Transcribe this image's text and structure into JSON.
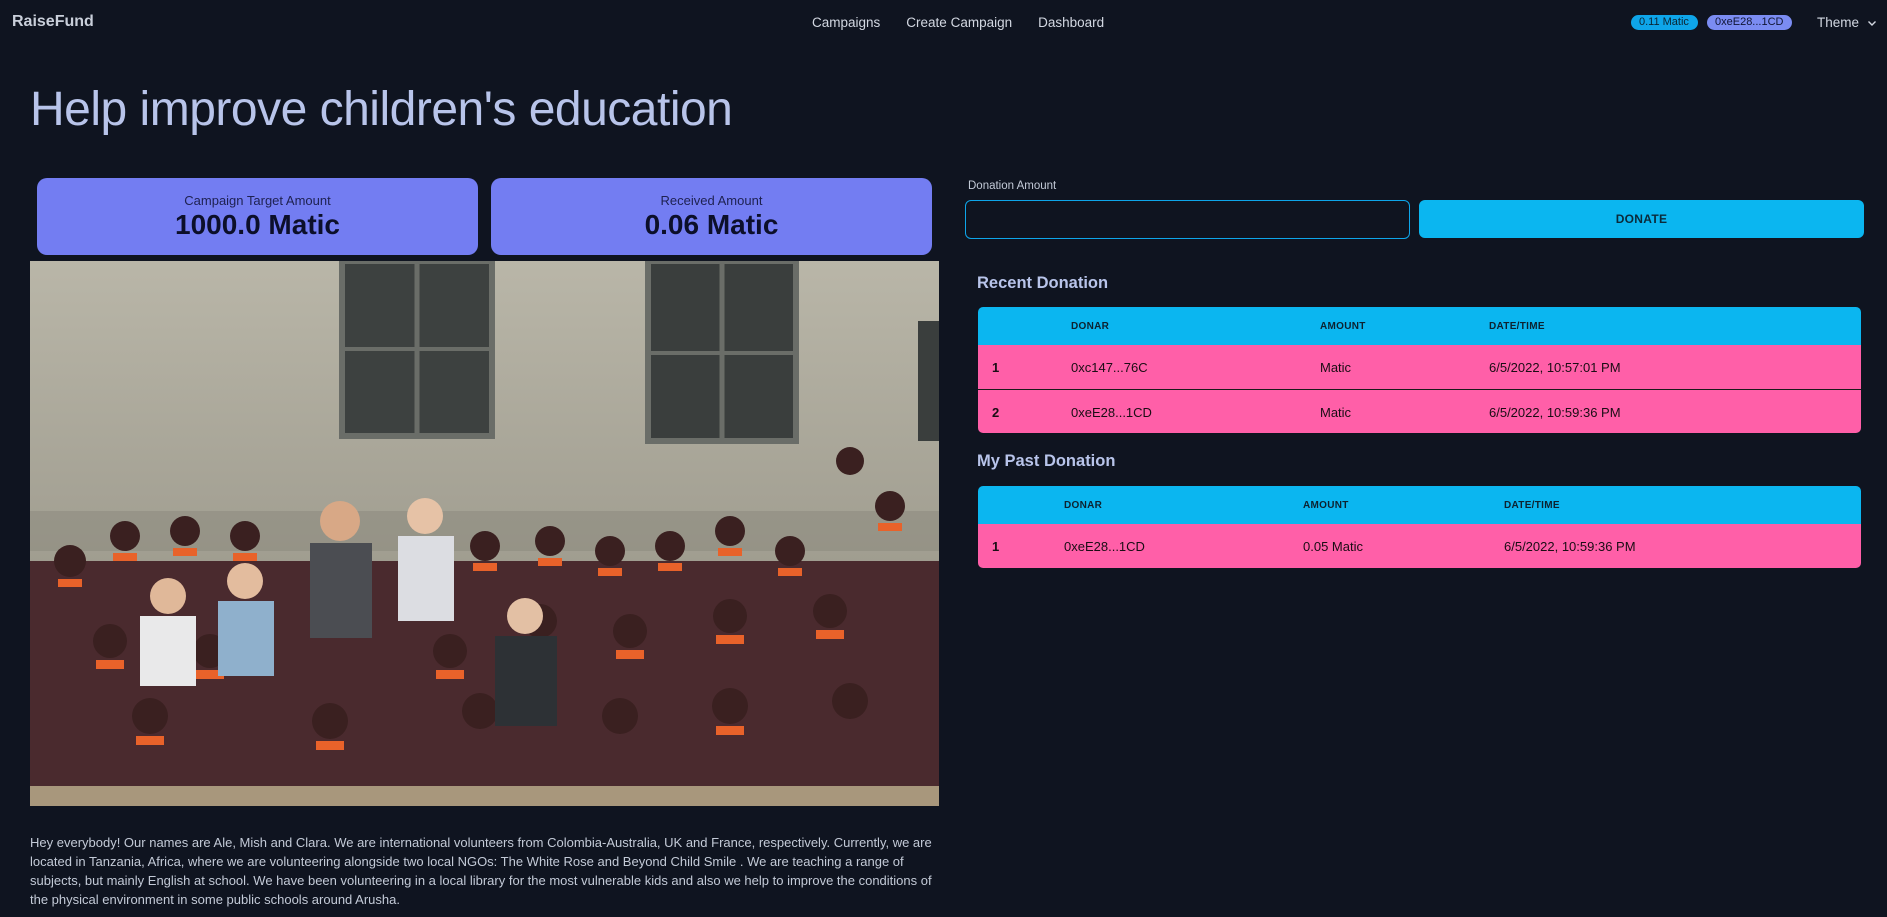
{
  "nav": {
    "brand": "RaiseFund",
    "links": [
      "Campaigns",
      "Create Campaign",
      "Dashboard"
    ],
    "balance": "0.11 Matic",
    "address": "0xeE28...1CD",
    "theme_label": "Theme"
  },
  "campaign": {
    "title": "Help improve children's education",
    "target_label": "Campaign Target Amount",
    "target_value": "1000.0 Matic",
    "received_label": "Received Amount",
    "received_value": "0.06 Matic",
    "description": "Hey everybody! Our names are Ale, Mish and Clara. We are international volunteers from Colombia-Australia, UK and France, respectively. Currently, we are located in Tanzania, Africa, where we are volunteering alongside two local NGOs: The White Rose and Beyond Child Smile . We are teaching a range of subjects, but mainly English at school. We have been volunteering in a local library for the most vulnerable kids and also we help to improve the conditions of the physical environment in some public schools around Arusha."
  },
  "donate": {
    "label": "Donation Amount",
    "input_value": "",
    "button_label": "DONATE"
  },
  "recent": {
    "title": "Recent Donation",
    "headers": [
      "DONAR",
      "AMOUNT",
      "DATE/TIME"
    ],
    "rows": [
      {
        "index": "1",
        "donor": "0xc147...76C",
        "amount": "Matic",
        "datetime": "6/5/2022, 10:57:01 PM"
      },
      {
        "index": "2",
        "donor": "0xeE28...1CD",
        "amount": "Matic",
        "datetime": "6/5/2022, 10:59:36 PM"
      }
    ]
  },
  "past": {
    "title": "My Past Donation",
    "headers": [
      "DONAR",
      "AMOUNT",
      "DATE/TIME"
    ],
    "rows": [
      {
        "index": "1",
        "donor": "0xeE28...1CD",
        "amount": "0.05 Matic",
        "datetime": "6/5/2022, 10:59:36 PM"
      }
    ]
  },
  "colors": {
    "background": "#0f1420",
    "stat_card": "#737df2",
    "accent_blue": "#0bb6f0",
    "row_pink": "#ff5fa8",
    "title": "#b8c4ea"
  }
}
